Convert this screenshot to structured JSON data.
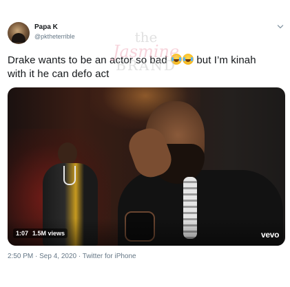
{
  "tweet": {
    "author": {
      "display_name": "Papa K",
      "handle": "@pktheterrible"
    },
    "text_line1": "Drake wants to be an actor so bad",
    "text_emojis": [
      "face-with-tears-of-joy",
      "face-with-tears-of-joy"
    ],
    "text_line1_tail": " but I’m kinah",
    "text_line2": "with it he can defo act",
    "watermark": {
      "line1": "the",
      "line2": "Jasmine",
      "line3": "BRAND"
    },
    "video": {
      "duration": "1:07",
      "views": "1.5M views",
      "brand": "vevo"
    },
    "meta": {
      "time": "2:50 PM",
      "separator1": " · ",
      "date": "Sep 4, 2020",
      "separator2": " · ",
      "client": "Twitter for iPhone"
    }
  }
}
